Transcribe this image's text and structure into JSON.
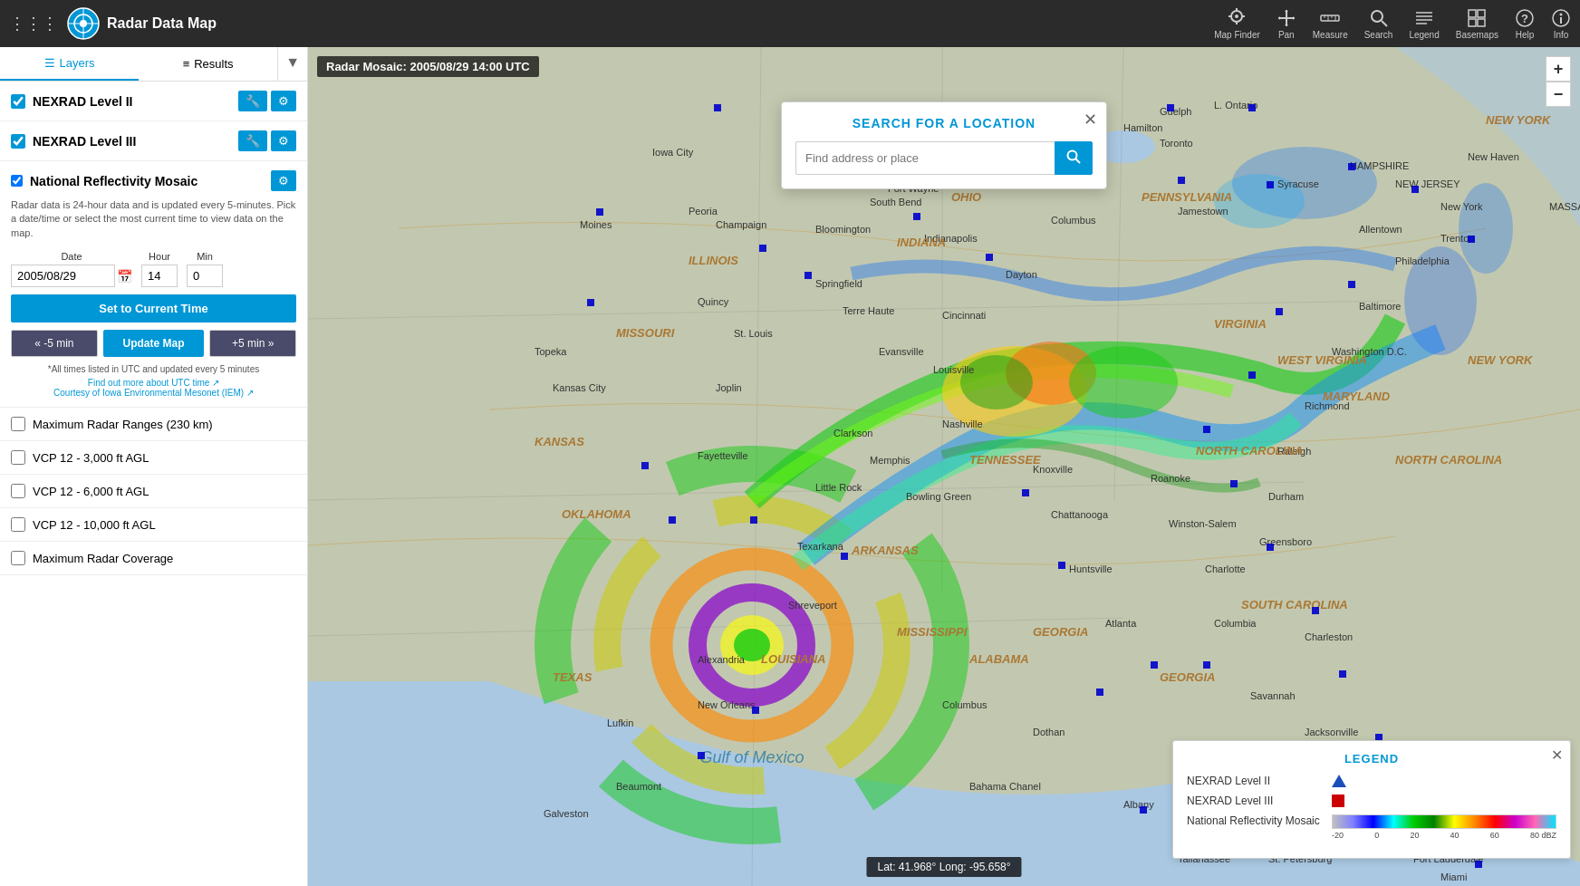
{
  "app": {
    "title": "Radar Data Map",
    "logo_alt": "NOAA logo"
  },
  "topbar": {
    "tools": [
      {
        "name": "map-finder",
        "label": "Map Finder"
      },
      {
        "name": "pan",
        "label": "Pan"
      },
      {
        "name": "measure",
        "label": "Measure"
      },
      {
        "name": "search",
        "label": "Search"
      },
      {
        "name": "legend",
        "label": "Legend"
      },
      {
        "name": "basemaps",
        "label": "Basemaps"
      },
      {
        "name": "help",
        "label": "Help"
      },
      {
        "name": "info",
        "label": "Info"
      }
    ]
  },
  "sidebar": {
    "tabs": [
      "Layers",
      "Results"
    ],
    "filter_icon": "▼"
  },
  "layers": [
    {
      "id": "nexrad2",
      "label": "NEXRAD Level II",
      "checked": true,
      "has_tools": true,
      "has_settings": true
    },
    {
      "id": "nexrad3",
      "label": "NEXRAD Level III",
      "checked": true,
      "has_tools": true,
      "has_settings": true
    },
    {
      "id": "mosaic",
      "label": "National Reflectivity Mosaic",
      "checked": true,
      "has_settings": true,
      "description": "Radar data is 24-hour data and is updated every 5-minutes. Pick a date/time or select the most current time to view data on the map.",
      "date_label": "Date",
      "hour_label": "Hour",
      "min_label": "Min",
      "date_value": "2005/08/29",
      "hour_value": "14",
      "min_value": "0",
      "set_time_btn": "Set to Current Time",
      "minus_btn": "« -5 min",
      "update_btn": "Update Map",
      "plus_btn": "+5 min »",
      "utc_note": "*All times listed in UTC and updated every 5 minutes",
      "utc_link": "Find out more about UTC time ↗",
      "iowa_link": "Courtesy of Iowa Environmental Mesonet (IEM) ↗"
    }
  ],
  "unchecked_layers": [
    {
      "id": "max_radar_ranges",
      "label": "Maximum Radar Ranges (230 km)"
    },
    {
      "id": "vcp12_3k",
      "label": "VCP 12 - 3,000 ft AGL"
    },
    {
      "id": "vcp12_6k",
      "label": "VCP 12 - 6,000 ft AGL"
    },
    {
      "id": "vcp12_10k",
      "label": "VCP 12 - 10,000 ft AGL"
    },
    {
      "id": "max_coverage",
      "label": "Maximum Radar Coverage"
    }
  ],
  "map": {
    "timestamp": "Radar Mosaic: 2005/08/29 14:00 UTC",
    "coords": "Lat: 41.968°  Long: -95.658°"
  },
  "search_dialog": {
    "title": "SEARCH FOR A LOCATION",
    "placeholder": "Find address or place"
  },
  "legend": {
    "title": "LEGEND",
    "items": [
      {
        "label": "NEXRAD Level II",
        "type": "triangle"
      },
      {
        "label": "NEXRAD Level III",
        "type": "square"
      },
      {
        "label": "National Reflectivity Mosaic",
        "type": "colorbar"
      }
    ],
    "colorbar_labels": [
      "-20",
      "0",
      "20",
      "40",
      "60",
      "80 dBZ"
    ]
  },
  "zoom": {
    "plus": "+",
    "minus": "−"
  }
}
